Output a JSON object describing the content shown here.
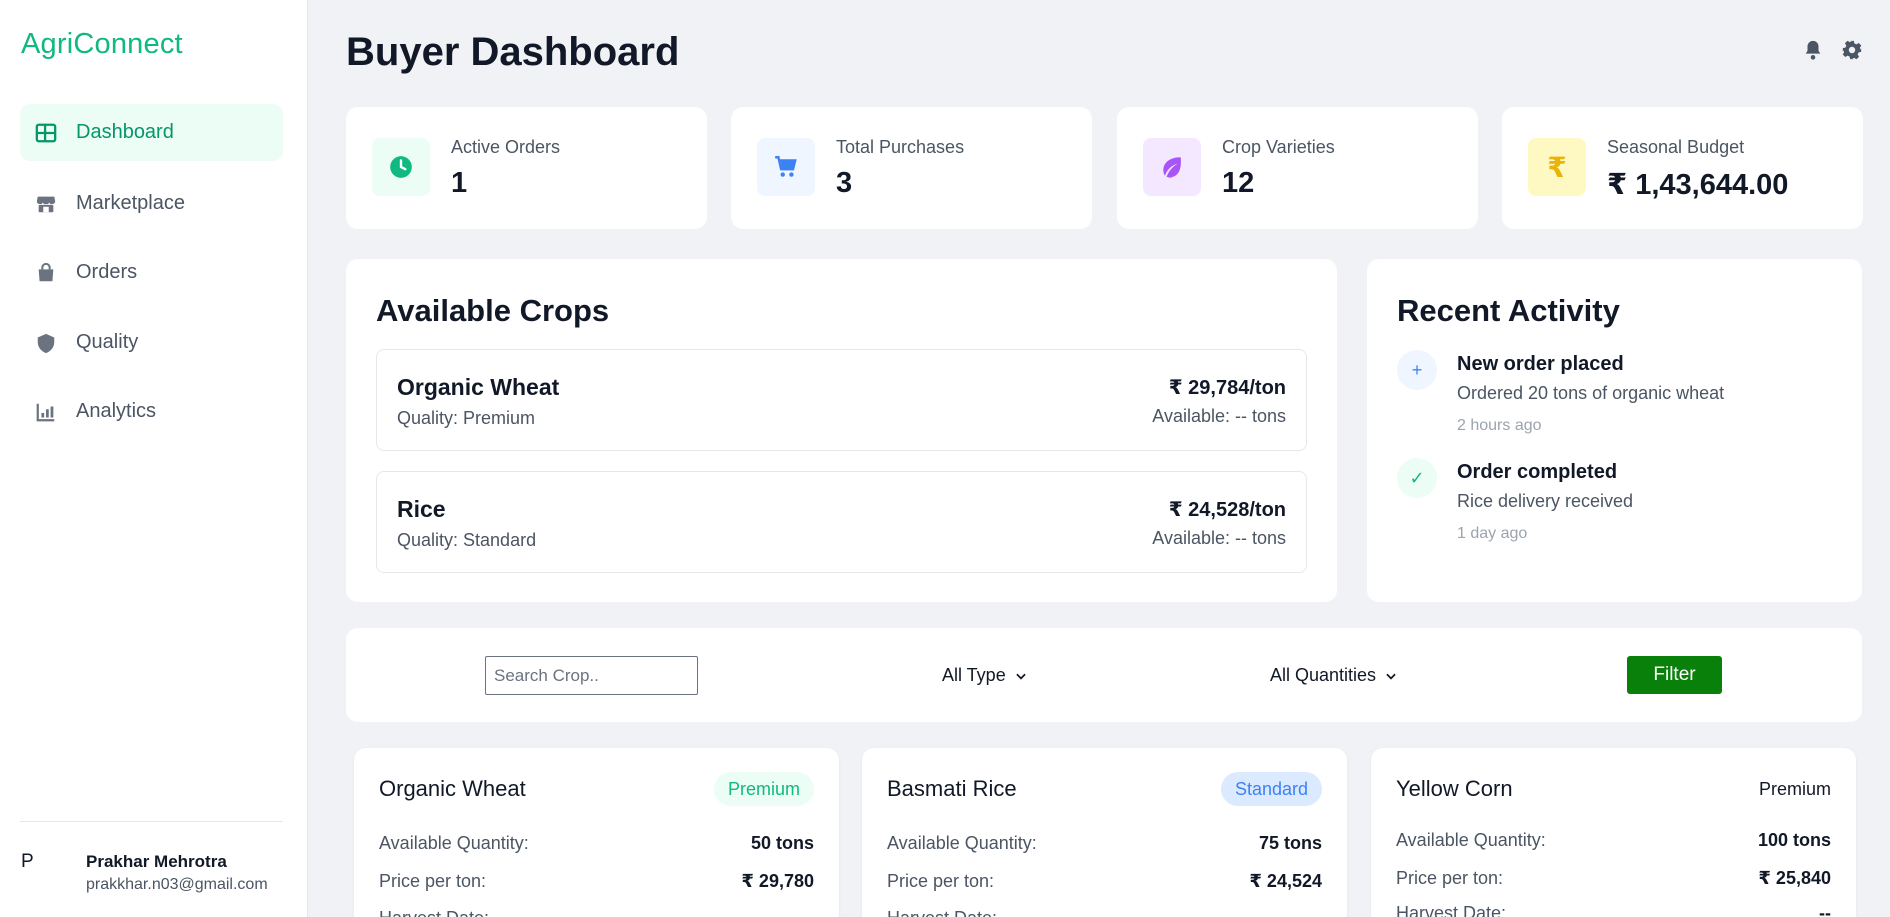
{
  "sidebar": {
    "brand": "AgriConnect",
    "items": [
      {
        "label": "Dashboard",
        "icon": "grid-icon"
      },
      {
        "label": "Marketplace",
        "icon": "store-icon"
      },
      {
        "label": "Orders",
        "icon": "bag-icon"
      },
      {
        "label": "Quality",
        "icon": "shield-icon"
      },
      {
        "label": "Analytics",
        "icon": "chart-icon"
      }
    ],
    "active_item": "Dashboard",
    "user": {
      "initial": "P",
      "name": "Prakhar Mehrotra",
      "email": "prakkhar.n03@gmail.com"
    }
  },
  "header": {
    "title": "Buyer Dashboard"
  },
  "stats": [
    {
      "label": "Active Orders",
      "value": "1",
      "icon": "clock-icon"
    },
    {
      "label": "Total Purchases",
      "value": "3",
      "icon": "cart-icon"
    },
    {
      "label": "Crop Varieties",
      "value": "12",
      "icon": "leaf-icon"
    },
    {
      "label": "Seasonal Budget",
      "value": "₹ 1,43,644.00",
      "icon": "rupee-icon"
    }
  ],
  "available_crops": {
    "title": "Available Crops",
    "items": [
      {
        "name": "Organic Wheat",
        "quality": "Quality: Premium",
        "price": "₹ 29,784/ton",
        "available": "Available: -- tons"
      },
      {
        "name": "Rice",
        "quality": "Quality: Standard",
        "price": "₹ 24,528/ton",
        "available": "Available: -- tons"
      }
    ]
  },
  "recent_activity": {
    "title": "Recent Activity",
    "items": [
      {
        "icon": "plus-icon",
        "symbol": "+",
        "title": "New order placed",
        "description": "Ordered 20 tons of organic wheat",
        "time": "2 hours ago"
      },
      {
        "icon": "check-icon",
        "symbol": "✓",
        "title": "Order completed",
        "description": "Rice delivery received",
        "time": "1 day ago"
      }
    ]
  },
  "filters": {
    "search_placeholder": "Search Crop..",
    "type_select": "All Type",
    "quantity_select": "All Quantities",
    "filter_label": "Filter"
  },
  "products": [
    {
      "name": "Organic Wheat",
      "badge": "Premium",
      "quantity_label": "Available Quantity:",
      "quantity": "50 tons",
      "price_label": "Price per ton:",
      "price": "₹ 29,780",
      "harvest_label": "Harvest Date:",
      "harvest": ""
    },
    {
      "name": "Basmati Rice",
      "badge": "Standard",
      "quantity_label": "Available Quantity:",
      "quantity": "75 tons",
      "price_label": "Price per ton:",
      "price": "₹ 24,524",
      "harvest_label": "Harvest Date:",
      "harvest": ""
    },
    {
      "name": "Yellow Corn",
      "badge": "Premium",
      "quantity_label": "Available Quantity:",
      "quantity": "100 tons",
      "price_label": "Price per ton:",
      "price": "₹ 25,840",
      "harvest_label": "Harvest Date:",
      "harvest": "--"
    }
  ],
  "colors": {
    "brand": "#10b981",
    "active_nav_bg": "#ecfdf5",
    "filter_button": "#098009",
    "page_bg": "#f1f2f6"
  }
}
